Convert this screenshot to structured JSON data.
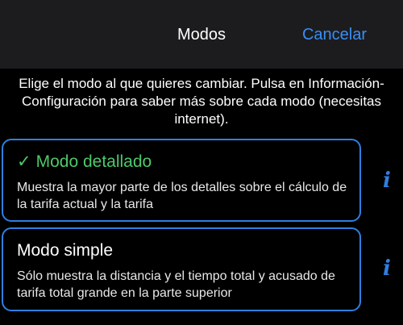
{
  "navbar": {
    "title": "Modos",
    "cancel_label": "Cancelar"
  },
  "intro_text": "Elige el modo al que quieres cambiar. Pulsa en Información-Configuración para saber más sobre cada modo (necesitas internet).",
  "modes": [
    {
      "check": "✓",
      "title": "Modo detallado",
      "description": "Muestra la mayor parte de los detalles sobre el cálculo de la tarifa actual y la tarifa",
      "selected": true,
      "info_icon": "i"
    },
    {
      "title": "Modo simple",
      "description": "Sólo muestra la distancia y el tiempo total y acusado de tarifa total grande en la parte superior",
      "selected": false,
      "info_icon": "i"
    }
  ],
  "colors": {
    "accent": "#2f7fe0",
    "selected_title": "#4cc86a",
    "navbar_bg": "#1c1c1e"
  }
}
